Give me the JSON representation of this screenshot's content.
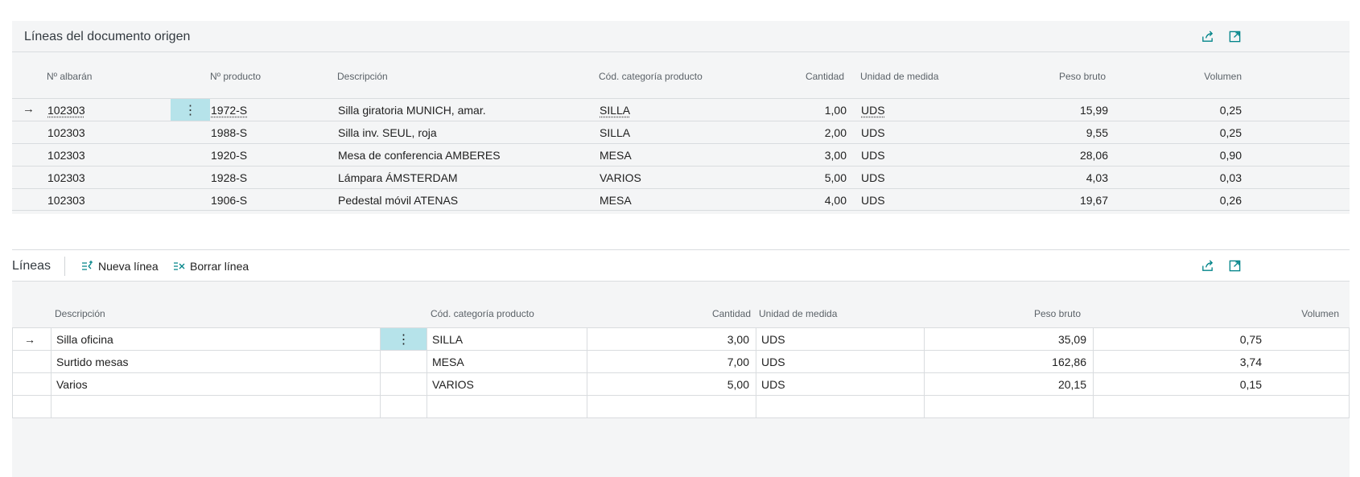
{
  "source_lines": {
    "title": "Líneas del documento origen",
    "columns": {
      "shipment_no": "Nº albarán",
      "product_no": "Nº producto",
      "description": "Descripción",
      "category": "Cód. categoría producto",
      "quantity": "Cantidad",
      "uom": "Unidad de medida",
      "gross_weight": "Peso bruto",
      "volume": "Volumen"
    },
    "rows": [
      {
        "shipment_no": "102303",
        "product_no": "1972-S",
        "description": "Silla giratoria MUNICH, amar.",
        "category": "SILLA",
        "quantity": "1,00",
        "uom": "UDS",
        "gross_weight": "15,99",
        "volume": "0,25"
      },
      {
        "shipment_no": "102303",
        "product_no": "1988-S",
        "description": "Silla inv. SEUL, roja",
        "category": "SILLA",
        "quantity": "2,00",
        "uom": "UDS",
        "gross_weight": "9,55",
        "volume": "0,25"
      },
      {
        "shipment_no": "102303",
        "product_no": "1920-S",
        "description": "Mesa de conferencia AMBERES",
        "category": "MESA",
        "quantity": "3,00",
        "uom": "UDS",
        "gross_weight": "28,06",
        "volume": "0,90"
      },
      {
        "shipment_no": "102303",
        "product_no": "1928-S",
        "description": "Lámpara ÁMSTERDAM",
        "category": "VARIOS",
        "quantity": "5,00",
        "uom": "UDS",
        "gross_weight": "4,03",
        "volume": "0,03"
      },
      {
        "shipment_no": "102303",
        "product_no": "1906-S",
        "description": "Pedestal móvil ATENAS",
        "category": "MESA",
        "quantity": "4,00",
        "uom": "UDS",
        "gross_weight": "19,67",
        "volume": "0,26"
      }
    ]
  },
  "lines": {
    "title": "Líneas",
    "new_line_label": "Nueva línea",
    "delete_line_label": "Borrar línea",
    "columns": {
      "description": "Descripción",
      "category": "Cód. categoría producto",
      "quantity": "Cantidad",
      "uom": "Unidad de medida",
      "gross_weight": "Peso bruto",
      "volume": "Volumen"
    },
    "rows": [
      {
        "description": "Silla oficina",
        "category": "SILLA",
        "quantity": "3,00",
        "uom": "UDS",
        "gross_weight": "35,09",
        "volume": "0,75"
      },
      {
        "description": "Surtido mesas",
        "category": "MESA",
        "quantity": "7,00",
        "uom": "UDS",
        "gross_weight": "162,86",
        "volume": "3,74"
      },
      {
        "description": "Varios",
        "category": "VARIOS",
        "quantity": "5,00",
        "uom": "UDS",
        "gross_weight": "20,15",
        "volume": "0,15"
      },
      {
        "description": "",
        "category": "",
        "quantity": "",
        "uom": "",
        "gross_weight": "",
        "volume": ""
      }
    ]
  },
  "icons": {
    "share": "share-icon",
    "expand": "expand-icon",
    "new_line": "new-line-icon",
    "delete_line": "delete-line-icon",
    "row_marker": "arrow-right-icon",
    "row_menu": "more-vertical-icon"
  },
  "colors": {
    "accent": "#008489",
    "selected_cell": "#b6e3ea",
    "panel_bg": "#f4f5f6"
  }
}
